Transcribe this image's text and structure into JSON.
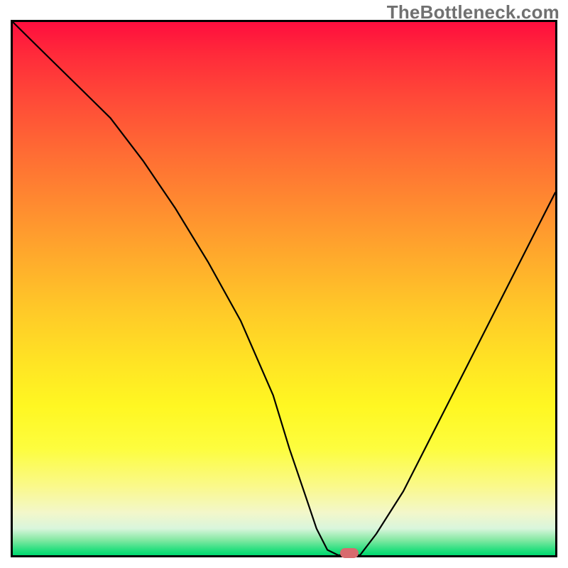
{
  "watermark": "TheBottleneck.com",
  "chart_data": {
    "type": "line",
    "title": "",
    "xlabel": "",
    "ylabel": "",
    "xlim": [
      0,
      100
    ],
    "ylim": [
      0,
      100
    ],
    "series": [
      {
        "name": "bottleneck-curve",
        "x": [
          0,
          6,
          12,
          18,
          24,
          30,
          36,
          42,
          48,
          51,
          54,
          56,
          58,
          60,
          62,
          64,
          67,
          72,
          78,
          84,
          90,
          96,
          100
        ],
        "y": [
          100,
          94,
          88,
          82,
          74,
          65,
          55,
          44,
          30,
          20,
          11,
          5,
          1,
          0,
          0,
          0,
          4,
          12,
          24,
          36,
          48,
          60,
          68
        ]
      }
    ],
    "marker": {
      "x": 62,
      "y": 0,
      "color": "#d86a6e"
    },
    "gradient_stops": [
      {
        "pos": 0,
        "color": "#ff0e3e"
      },
      {
        "pos": 20,
        "color": "#ff5a36"
      },
      {
        "pos": 40,
        "color": "#ffa02c"
      },
      {
        "pos": 60,
        "color": "#ffe024"
      },
      {
        "pos": 80,
        "color": "#fdfa4a"
      },
      {
        "pos": 95,
        "color": "#d8f6d2"
      },
      {
        "pos": 100,
        "color": "#00d96f"
      }
    ],
    "legend": [],
    "grid": false
  }
}
